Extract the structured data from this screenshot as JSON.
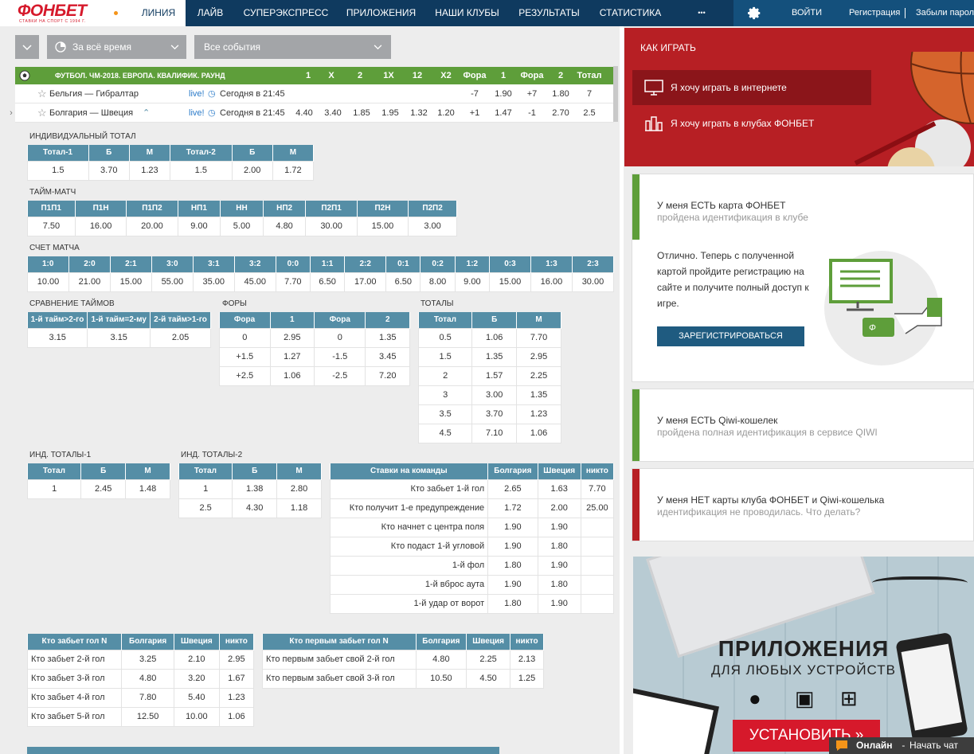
{
  "header": {
    "logo": "ФОНБЕТ",
    "logo_sub": "СТАВКИ НА СПОРТ С 1994 Г.",
    "nav": [
      "ЛИНИЯ",
      "ЛАЙВ",
      "СУПЕРЭКСПРЕСС",
      "ПРИЛОЖЕНИЯ",
      "НАШИ КЛУБЫ",
      "РЕЗУЛЬТАТЫ",
      "СТАТИСТИКА",
      "•••"
    ],
    "login": "ВОЙТИ",
    "register": "Регистрация",
    "forgot": "Забыли пароль"
  },
  "filters": {
    "period": "За всё время",
    "events": "Все события"
  },
  "event_header": {
    "title": "ФУТБОЛ. ЧМ-2018. ЕВРОПА. КВАЛИФИК. РАУНД",
    "cols": [
      "1",
      "X",
      "2",
      "1X",
      "12",
      "X2",
      "Фора",
      "1",
      "Фора",
      "2",
      "Тотал"
    ]
  },
  "matches": [
    {
      "name": "Бельгия — Гибралтар",
      "live": "live!",
      "time": "Сегодня в 21:45",
      "odds": [
        "",
        "",
        "",
        "",
        "",
        "",
        "-7",
        "1.90",
        "+7",
        "1.80",
        "7"
      ]
    },
    {
      "name": "Болгария — Швеция",
      "live": "live!",
      "time": "Сегодня в 21:45",
      "odds": [
        "4.40",
        "3.40",
        "1.85",
        "1.95",
        "1.32",
        "1.20",
        "+1",
        "1.47",
        "-1",
        "2.70",
        "2.5"
      ]
    }
  ],
  "ind_total": {
    "title": "ИНДИВИДУАЛЬНЫЙ ТОТАЛ",
    "head": [
      "Тотал-1",
      "Б",
      "М",
      "Тотал-2",
      "Б",
      "М"
    ],
    "rows": [
      [
        "1.5",
        "3.70",
        "1.23",
        "1.5",
        "2.00",
        "1.72"
      ]
    ]
  },
  "time_match": {
    "title": "ТАЙМ-МАТЧ",
    "head": [
      "П1П1",
      "П1Н",
      "П1П2",
      "НП1",
      "НН",
      "НП2",
      "П2П1",
      "П2Н",
      "П2П2"
    ],
    "rows": [
      [
        "7.50",
        "16.00",
        "20.00",
        "9.00",
        "5.00",
        "4.80",
        "30.00",
        "15.00",
        "3.00"
      ]
    ]
  },
  "score": {
    "title": "СЧЕТ МАТЧА",
    "head": [
      "1:0",
      "2:0",
      "2:1",
      "3:0",
      "3:1",
      "3:2",
      "0:0",
      "1:1",
      "2:2",
      "0:1",
      "0:2",
      "1:2",
      "0:3",
      "1:3",
      "2:3"
    ],
    "rows": [
      [
        "10.00",
        "21.00",
        "15.00",
        "55.00",
        "35.00",
        "45.00",
        "7.70",
        "6.50",
        "17.00",
        "6.50",
        "8.00",
        "9.00",
        "15.00",
        "16.00",
        "30.00"
      ]
    ]
  },
  "halves": {
    "title": "СРАВНЕНИЕ ТАЙМОВ",
    "head": [
      "1-й тайм>2-го",
      "1-й тайм=2-му",
      "2-й тайм>1-го"
    ],
    "rows": [
      [
        "3.15",
        "3.15",
        "2.05"
      ]
    ]
  },
  "fora": {
    "title": "ФОРЫ",
    "head": [
      "Фора",
      "1",
      "Фора",
      "2"
    ],
    "rows": [
      [
        "0",
        "2.95",
        "0",
        "1.35"
      ],
      [
        "+1.5",
        "1.27",
        "-1.5",
        "3.45"
      ],
      [
        "+2.5",
        "1.06",
        "-2.5",
        "7.20"
      ]
    ]
  },
  "totals": {
    "title": "ТОТАЛЫ",
    "head": [
      "Тотал",
      "Б",
      "М"
    ],
    "rows": [
      [
        "0.5",
        "1.06",
        "7.70"
      ],
      [
        "1.5",
        "1.35",
        "2.95"
      ],
      [
        "2",
        "1.57",
        "2.25"
      ],
      [
        "3",
        "3.00",
        "1.35"
      ],
      [
        "3.5",
        "3.70",
        "1.23"
      ],
      [
        "4.5",
        "7.10",
        "1.06"
      ]
    ]
  },
  "ind1": {
    "title": "ИНД. ТОТАЛЫ-1",
    "head": [
      "Тотал",
      "Б",
      "М"
    ],
    "rows": [
      [
        "1",
        "2.45",
        "1.48"
      ]
    ]
  },
  "ind2": {
    "title": "ИНД. ТОТАЛЫ-2",
    "head": [
      "Тотал",
      "Б",
      "М"
    ],
    "rows": [
      [
        "1",
        "1.38",
        "2.80"
      ],
      [
        "2.5",
        "4.30",
        "1.18"
      ]
    ]
  },
  "team_bets": {
    "head": [
      "Ставки на команды",
      "Болгария",
      "Швеция",
      "никто"
    ],
    "rows": [
      [
        "Кто забьет 1-й гол",
        "2.65",
        "1.63",
        "7.70"
      ],
      [
        "Кто получит 1-е предупреждение",
        "1.72",
        "2.00",
        "25.00"
      ],
      [
        "Кто начнет с центра поля",
        "1.90",
        "1.90",
        ""
      ],
      [
        "Кто подаст 1-й угловой",
        "1.90",
        "1.80",
        ""
      ],
      [
        "1-й фол",
        "1.80",
        "1.90",
        ""
      ],
      [
        "1-й вброс аута",
        "1.90",
        "1.80",
        ""
      ],
      [
        "1-й удар от ворот",
        "1.80",
        "1.90",
        ""
      ]
    ]
  },
  "goal_n": {
    "head": [
      "Кто забьет гол N",
      "Болгария",
      "Швеция",
      "никто"
    ],
    "rows": [
      [
        "Кто забьет 2-й гол",
        "3.25",
        "2.10",
        "2.95"
      ],
      [
        "Кто забьет 3-й гол",
        "4.80",
        "3.20",
        "1.67"
      ],
      [
        "Кто забьет 4-й гол",
        "7.80",
        "5.40",
        "1.23"
      ],
      [
        "Кто забьет 5-й гол",
        "12.50",
        "10.00",
        "1.06"
      ]
    ]
  },
  "first_goal": {
    "head": [
      "Кто первым забьет гол N",
      "Болгария",
      "Швеция",
      "никто"
    ],
    "rows": [
      [
        "Кто первым забьет свой 2-й гол",
        "4.80",
        "2.25",
        "2.13"
      ],
      [
        "Кто первым забьет свой 3-й гол",
        "10.50",
        "4.50",
        "1.25"
      ]
    ]
  },
  "how_to": {
    "title": "КАК ИГРАТЬ",
    "opt1": "Я хочу играть в интернете",
    "opt2": "Я хочу играть в клубах ФОНБЕТ"
  },
  "card1": {
    "title": "У меня ЕСТЬ карта ФОНБЕТ",
    "sub": "пройдена идентификация в клубе",
    "text": "Отлично. Теперь с полученной картой пройдите регистрацию на сайте и получите полный доступ к игре.",
    "button": "ЗАРЕГИСТРИРОВАТЬСЯ"
  },
  "card2": {
    "title": "У меня ЕСТЬ Qiwi-кошелек",
    "sub": "пройдена полная идентификация в сервисе QIWI"
  },
  "card3": {
    "title": "У меня НЕТ карты клуба ФОНБЕТ и Qiwi-кошелька",
    "sub": "идентификация не проводилась. Что делать?"
  },
  "promo": {
    "title": "ПРИЛОЖЕНИЯ",
    "sub": "ДЛЯ ЛЮБЫХ УСТРОЙСТВ",
    "button": "УСТАНОВИТЬ »"
  },
  "chat": {
    "online": "Онлайн",
    "sep": " - ",
    "label": "Начать чат"
  },
  "colors": {
    "nav": "#0f3a5f",
    "brand": "#d6192b",
    "green": "#5e9e3a",
    "table_head": "#558ea6",
    "red_panel": "#b71f24",
    "button": "#1f5b80"
  }
}
